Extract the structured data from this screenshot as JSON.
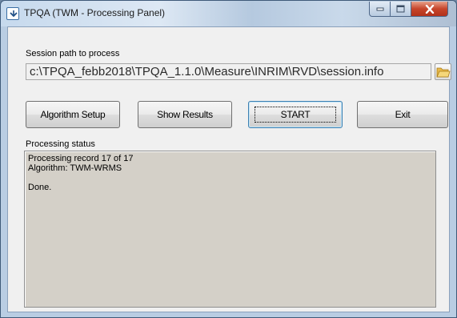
{
  "window": {
    "title": "TPQA  (TWM - Processing Panel)"
  },
  "session": {
    "label": "Session path to process",
    "path": "c:\\TPQA_febb2018\\TPQA_1.1.0\\Measure\\INRIM\\RVD\\session.info"
  },
  "buttons": {
    "algorithm_setup": "Algorithm Setup",
    "show_results": "Show Results",
    "start": "START",
    "exit": "Exit"
  },
  "status": {
    "label": "Processing status",
    "lines": [
      "Processing record 17 of 17",
      "Algorithm: TWM-WRMS",
      "",
      "Done."
    ]
  },
  "colors": {
    "title_bar": "#c6d9ed",
    "close_button": "#c6452b",
    "client_background": "#f0f0f0",
    "status_background": "#d4d0c8"
  }
}
